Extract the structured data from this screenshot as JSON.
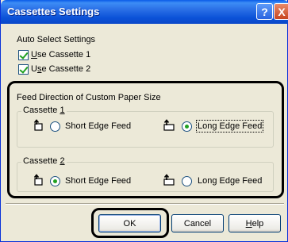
{
  "window": {
    "title": "Cassettes Settings"
  },
  "title_buttons": {
    "help": "?",
    "close": "X"
  },
  "auto_select": {
    "label": "Auto Select Settings",
    "use_cassette_1": {
      "prefix": "",
      "mnemonic": "U",
      "rest": "se Cassette 1",
      "checked": true
    },
    "use_cassette_2": {
      "prefix": "U",
      "mnemonic": "s",
      "rest": "e Cassette 2",
      "checked": true
    }
  },
  "feed_direction": {
    "label": "Feed Direction of Custom Paper Size",
    "cassette_1": {
      "legend_prefix": "Cassette ",
      "legend_mnemonic": "1",
      "short_edge_label": "Short Edge Feed",
      "long_edge_label": "Long Edge Feed",
      "selected": "long"
    },
    "cassette_2": {
      "legend_prefix": "Cassette ",
      "legend_mnemonic": "2",
      "short_edge_label": "Short Edge Feed",
      "long_edge_label": "Long Edge Feed",
      "selected": "short"
    }
  },
  "buttons": {
    "ok": "OK",
    "cancel": "Cancel",
    "help_mnemonic": "H",
    "help_rest": "elp"
  }
}
